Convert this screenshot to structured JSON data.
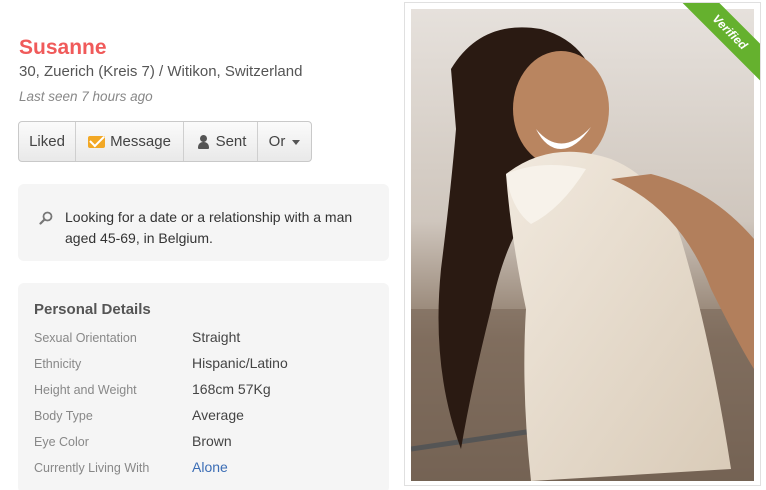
{
  "profile": {
    "name": "Susanne",
    "location": "30, Zuerich (Kreis 7) / Witikon, Switzerland",
    "last_seen": "Last seen 7 hours ago"
  },
  "actions": {
    "liked": "Liked",
    "message": "Message",
    "sent": "Sent",
    "more": "Or"
  },
  "looking_for": {
    "text": "Looking for a date or a relationship with a man aged 45-69, in Belgium."
  },
  "personal_details": {
    "title": "Personal Details",
    "rows": [
      {
        "label": "Sexual Orientation",
        "value": "Straight"
      },
      {
        "label": "Ethnicity",
        "value": "Hispanic/Latino"
      },
      {
        "label": "Height and Weight",
        "value": "168cm 57Kg"
      },
      {
        "label": "Body Type",
        "value": "Average"
      },
      {
        "label": "Eye Color",
        "value": "Brown"
      },
      {
        "label": "Currently Living With",
        "value": "Alone"
      }
    ]
  },
  "photo": {
    "badge": "Verified"
  },
  "colors": {
    "name": "#f05a5a",
    "badge": "#65b12e",
    "link": "#3b6db5"
  }
}
